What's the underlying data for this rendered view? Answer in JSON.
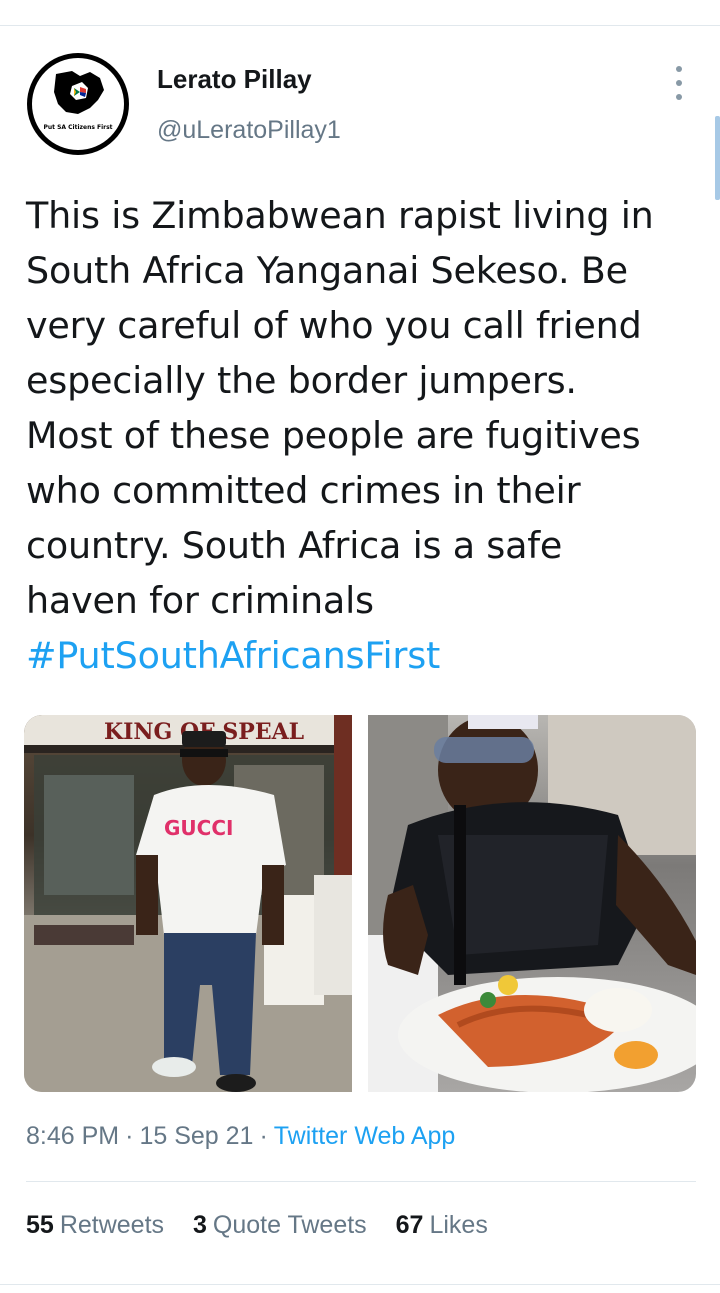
{
  "tweet": {
    "author": {
      "display_name": "Lerato Pillay",
      "handle": "@uLeratoPillay1",
      "avatar_text": "Put SA Citizens First"
    },
    "text_lines": [
      "This is Zimbabwean rapist living in",
      "South Africa Yanganai Sekeso. Be",
      "very careful of who you call friend",
      "especially the border jumpers.",
      "Most of these people are fugitives",
      "who committed crimes in their",
      "country. South Africa is a safe",
      "haven for criminals"
    ],
    "hashtag": "#PutSouthAfricansFirst",
    "media": {
      "left_photo_sign_text": "KING OF SPEAL",
      "left_photo_shirt_text": "GUCCI"
    },
    "time": "8:46 PM",
    "date": "15 Sep 21",
    "separator": "·",
    "source": "Twitter Web App",
    "stats": {
      "retweets_count": "55",
      "retweets_label": "Retweets",
      "quotes_count": "3",
      "quotes_label": "Quote Tweets",
      "likes_count": "67",
      "likes_label": "Likes"
    }
  },
  "icons": {
    "more": "more-vertical-icon",
    "avatar_map": "south-africa-map-icon"
  },
  "colors": {
    "link": "#1da1f2",
    "secondary_text": "#657786",
    "primary_text": "#14171a",
    "divider": "#e1e8ed"
  }
}
